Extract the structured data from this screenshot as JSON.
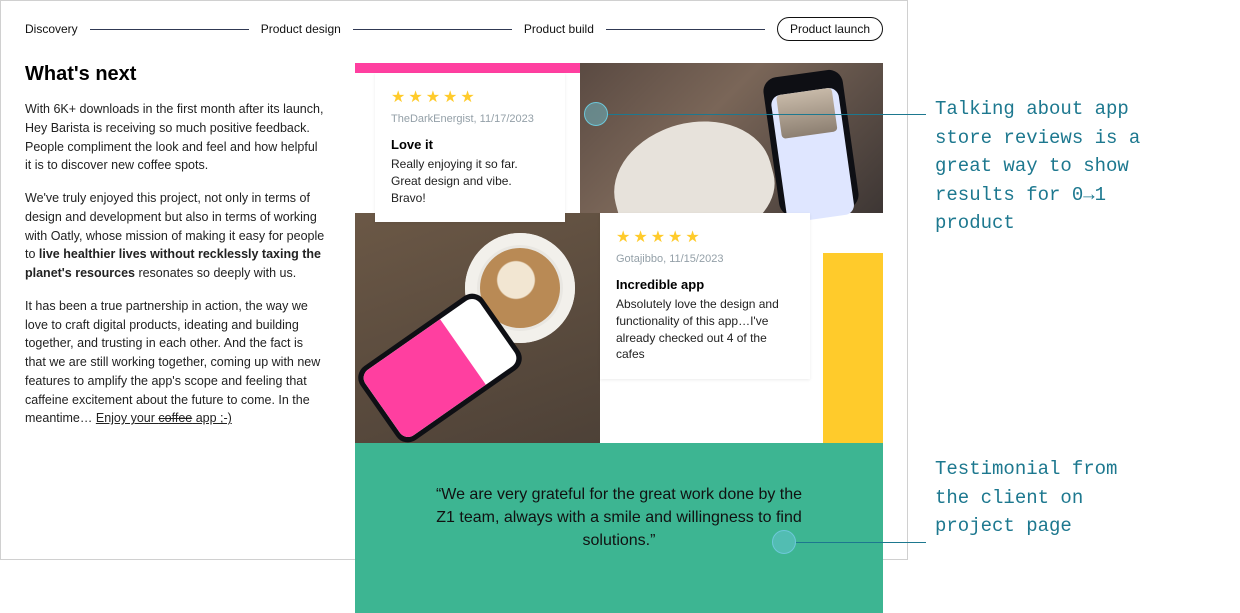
{
  "stepper": {
    "items": [
      "Discovery",
      "Product design",
      "Product build",
      "Product launch"
    ],
    "active_index": 3
  },
  "left": {
    "heading": "What's next",
    "p1": "With 6K+ downloads in the first month after its launch, Hey Barista is receiving so much positive feedback. People compliment the look and feel and how helpful it is to discover new coffee spots.",
    "p2a": "We've truly enjoyed this project, not only in terms of design and development but also in terms of working with Oatly, whose mission of making it easy for people to ",
    "p2b": "live healthier lives without recklessly taxing the planet's resources",
    "p2c": " resonates so deeply with us.",
    "p3a": "It has been a true partnership in action, the way we love to craft digital products, ideating and building together, and trusting in each other. And the fact is that we are still working together, coming up with new features to amplify the app's scope and feeling that caffeine excitement about the future to come. In the meantime… ",
    "p3b": "Enjoy your ",
    "p3c": "coffee",
    "p3d": " app ;-)"
  },
  "reviews": [
    {
      "stars": "★★★★★",
      "meta": "TheDarkEnergist, 11/17/2023",
      "title": "Love it",
      "body": "Really enjoying it so far. Great design and vibe. Bravo!"
    },
    {
      "stars": "★★★★★",
      "meta": "Gotajibbo, 11/15/2023",
      "title": "Incredible app",
      "body": "Absolutely love the design and functionality of this app…I've already checked out 4 of the cafes"
    }
  ],
  "quote": "“We are very grateful for the great work done by the Z1 team, always with a smile and willingness to find solutions.”",
  "annotations": {
    "a1_l1": "Talking about app",
    "a1_l2": "store reviews is a",
    "a1_l3": "great way to show",
    "a1_l4": "results for 0→1",
    "a1_l5": "product",
    "a2_l1": "Testimonial from",
    "a2_l2": "the client on",
    "a2_l3": "project page"
  },
  "colors": {
    "pink": "#ff3fa0",
    "yellow": "#ffcb2b",
    "green": "#3db592",
    "teal": "#1d788f"
  }
}
